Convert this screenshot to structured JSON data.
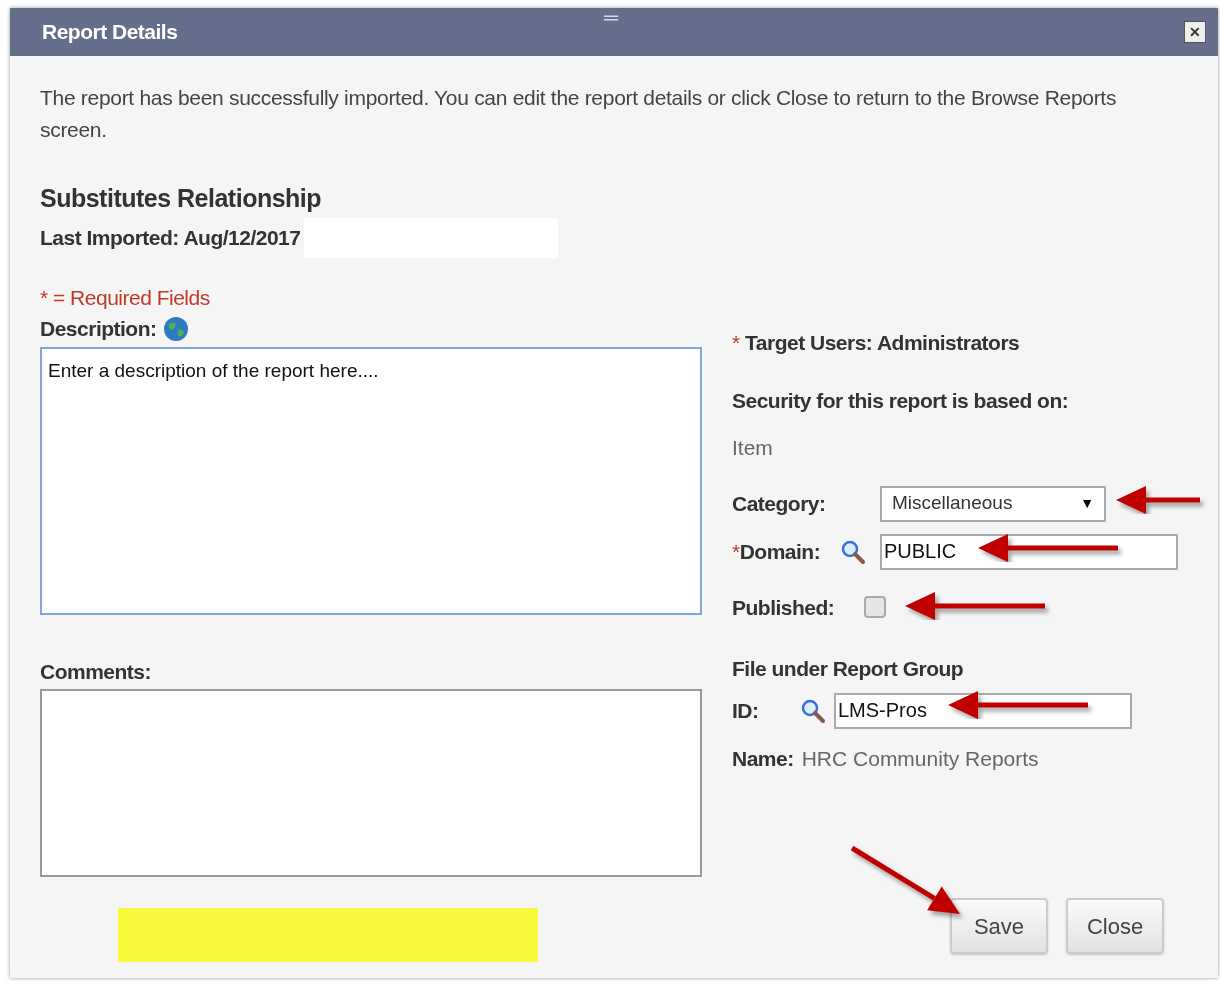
{
  "window": {
    "title": "Report Details",
    "drag_handle": "═",
    "close": "✕"
  },
  "message": "The report has been successfully imported. You can edit the report details or click Close to return to the Browse Reports screen.",
  "report": {
    "name": "Substitutes Relationship",
    "last_imported": "Last Imported: Aug/12/2017"
  },
  "required_note": "* = Required Fields",
  "description": {
    "label": "Description:",
    "value": "Enter a description of the report here....",
    "focused": true
  },
  "comments": {
    "label": "Comments:",
    "focused": false
  },
  "target_users": {
    "mark": "*",
    "text": "Target Users: Administrators"
  },
  "security": {
    "label": "Security for this report is based on:",
    "value": "Item"
  },
  "category": {
    "label": "Category:",
    "value": "Miscellaneous",
    "caret": "▼"
  },
  "domain": {
    "mark": "*",
    "label": "Domain:",
    "value": "PUBLIC"
  },
  "published": {
    "label": "Published:",
    "checked": false
  },
  "report_group": {
    "title": "File under Report Group",
    "id_label": "ID:",
    "id_value": "LMS-Pros",
    "name_label": "Name:",
    "name_value": "HRC Community Reports"
  },
  "buttons": [
    {
      "label": "Save"
    },
    {
      "label": "Close"
    }
  ]
}
